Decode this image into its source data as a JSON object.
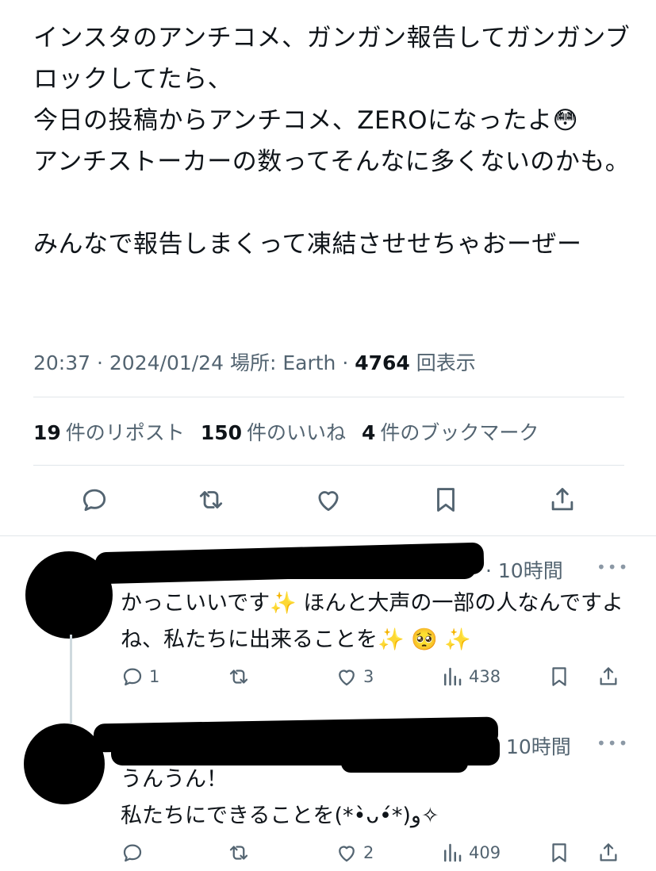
{
  "tweet": {
    "text": "インスタのアンチコメ、ガンガン報告してガンガンブロックしてたら、\n今日の投稿からアンチコメ、ZEROになったよ😳\nアンチストーカーの数ってそんなに多くないのかも。\n\nみんなで報告しまくって凍結させせちゃおーぜー",
    "time": "20:37",
    "date": "2024/01/24",
    "location_label": "場所:",
    "location": "Earth",
    "views": "4764",
    "views_label": "回表示"
  },
  "stats": {
    "reposts_count": "19",
    "reposts_label": "件のリポスト",
    "likes_count": "150",
    "likes_label": "件のいいね",
    "bookmarks_count": "4",
    "bookmarks_label": "件のブックマーク"
  },
  "actions": [
    "reply-icon",
    "repost-icon",
    "like-icon",
    "bookmark-icon",
    "share-icon"
  ],
  "replies": [
    {
      "time": "10時間",
      "more": "•••",
      "text": "かっこいいです✨ ほんと大声の一部の人なんですよね、私たちに出来ることを✨ 🥺 ✨",
      "reply_count": "1",
      "repost_count": "",
      "like_count": "3",
      "view_count": "438"
    },
    {
      "time": "10時間",
      "more": "•••",
      "text": "うんうん！\n私たちにできることを(*•̀ᴗ•́*)و✧",
      "reply_count": "",
      "repost_count": "",
      "like_count": "2",
      "view_count": "409"
    }
  ],
  "colors": {
    "text": "#0f1419",
    "secondary": "#536471",
    "divider": "#e1e6ea"
  }
}
